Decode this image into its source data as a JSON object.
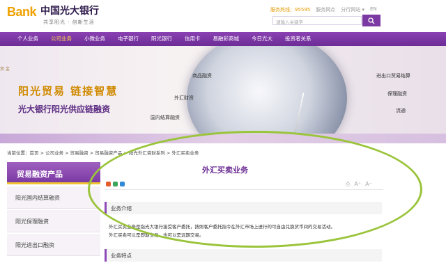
{
  "header": {
    "logo_bank": "Bank",
    "logo_name": "中国光大银行",
    "slogan": "共享阳光 · 创新生活",
    "hotline": "服务热线：95595",
    "links": [
      "服务网点",
      "分行网站 ▾",
      "EN"
    ],
    "search_placeholder": "请输入关键字"
  },
  "nav": {
    "items": [
      "个人业务",
      "公司业务",
      "小微业务",
      "电子银行",
      "阳光银行",
      "信用卡",
      "易融彩商城",
      "今日光大",
      "投资者关系"
    ],
    "active_index": 1
  },
  "banner": {
    "corner_text": "贸 金",
    "title1": "阳光贸易 链接智慧",
    "title2": "光大银行阳光供应链融资",
    "labels": [
      "商品融资",
      "外汇财资",
      "国内结算融资",
      "进出口贸易结算",
      "保理融资",
      "流通"
    ]
  },
  "breadcrumb": "当前位置：首页 > 公司业务 > 贸易融资 > 贸易融资产品 > 阳光外汇资财系列 > 外汇买卖业务",
  "sidebar": {
    "title": "贸易融资产品",
    "items": [
      "阳光国内结算融资",
      "阳光保理融资",
      "阳光进出口融资"
    ]
  },
  "content": {
    "title": "外汇买卖业务",
    "tools": [
      "⎙",
      "A⁺",
      "A⁻"
    ],
    "section1_title": "业务介绍",
    "section1_text1": "外汇买卖业务是指光大银行接受客户委托，按照客户委托指令在外汇市场上进行的可自由兑换货币间的交易活动。",
    "section1_text2": "外汇买卖可以是即期交易，也可以是远期交易。",
    "section2_title": "业务特点"
  },
  "colors": {
    "brand_purple": "#7b3aa3",
    "brand_orange": "#f0a100",
    "annotation_green": "#9ac43a"
  }
}
